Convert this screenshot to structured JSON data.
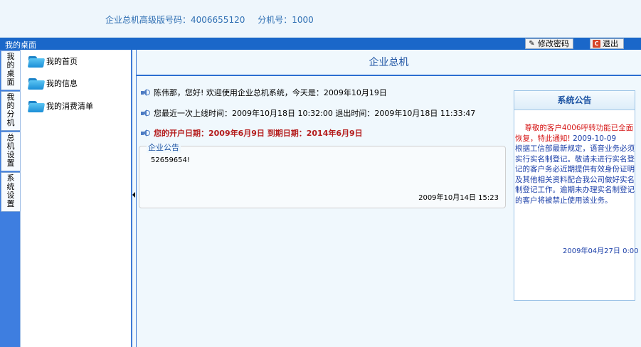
{
  "header": {
    "product_label": "企业总机高级版号码：4006655120",
    "extension_label": "分机号：1000"
  },
  "titlebar": {
    "desk_title": "我的桌面",
    "change_password": "修改密码",
    "logout": "退出"
  },
  "tabs": [
    {
      "label": [
        "我",
        "的",
        "桌",
        "面"
      ]
    },
    {
      "label": [
        "我",
        "的",
        "分",
        "机"
      ]
    },
    {
      "label": [
        "总",
        "机",
        "设",
        "置"
      ]
    },
    {
      "label": [
        "系",
        "统",
        "设",
        "置"
      ]
    }
  ],
  "tree": {
    "items": [
      {
        "label": "我的首页"
      },
      {
        "label": "我的信息"
      },
      {
        "label": "我的消费清单"
      }
    ]
  },
  "main": {
    "title": "企业总机",
    "welcome": "陈伟那，您好! 欢迎使用企业总机系统，今天是：2009年10月19日",
    "last_login": "您最近一次上线时间：2009年10月18日 10:32:00 退出时间：2009年10月18日 11:33:47",
    "account_dates": "您的开户日期：2009年6月9日  到期日期：2014年6月9日",
    "notice": {
      "legend": "企业公告",
      "content": "52659654!",
      "time": "2009年10月14日 15:23"
    }
  },
  "system_notice": {
    "title": "系统公告",
    "red_text": "尊敬的客户4006呼转功能已全面恢复，特此通知!",
    "date": "2009-10-09",
    "body": "根据工信部最新规定，语音业务必须实行实名制登记。敬请未进行实名登记的客户务必近期提供有效身份证明及其他相关资料配合我公司做好实名制登记工作。逾期未办理实名制登记的客户将被禁止使用该业务。",
    "time": "2009年04月27日 0:00"
  }
}
